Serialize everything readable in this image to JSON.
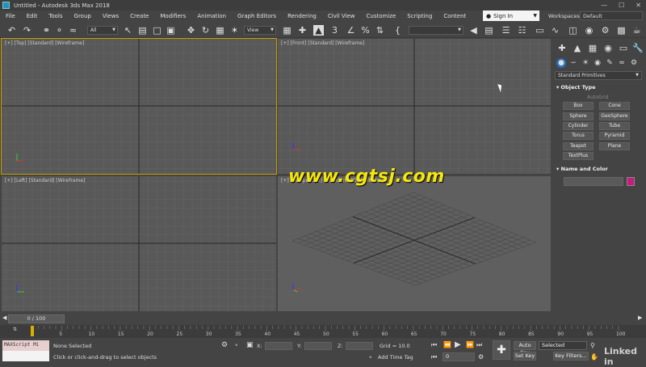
{
  "window": {
    "title": "Untitled - Autodesk 3ds Max 2018",
    "controls": [
      "—",
      "☐",
      "✕"
    ]
  },
  "menu": [
    "File",
    "Edit",
    "Tools",
    "Group",
    "Views",
    "Create",
    "Modifiers",
    "Animation",
    "Graph Editors",
    "Rendering",
    "Civil View",
    "Customize",
    "Scripting",
    "Content"
  ],
  "signin": {
    "label": "Sign In"
  },
  "workspaces": {
    "label": "Workspaces:",
    "value": "Default"
  },
  "toolbar": {
    "filter_value": "All",
    "refcoord_value": "View",
    "named_selection": ""
  },
  "viewports": [
    {
      "label": "[+] [Top] [Standard] [Wireframe]",
      "active": true
    },
    {
      "label": "[+] [Front] [Standard] [Wireframe]",
      "active": false
    },
    {
      "label": "[+] [Left] [Standard] [Wireframe]",
      "active": false
    },
    {
      "label": "[+] [Perspective] [Standard] [Default Shading]",
      "active": false
    }
  ],
  "command_panel": {
    "dropdown": "Standard Primitives",
    "object_type_title": "Object Type",
    "autogrid": "AutoGrid",
    "buttons": [
      "Box",
      "Cone",
      "Sphere",
      "GeoSphere",
      "Cylinder",
      "Tube",
      "Torus",
      "Pyramid",
      "Teapot",
      "Plane",
      "TextPlus"
    ],
    "name_color_title": "Name and Color",
    "swatch_color": "#c41d7c"
  },
  "time": {
    "slider_label": "0 / 100",
    "ticks": [
      "0",
      "5",
      "10",
      "15",
      "20",
      "25",
      "30",
      "35",
      "40",
      "45",
      "50",
      "55",
      "60",
      "65",
      "70",
      "75",
      "80",
      "85",
      "90",
      "95",
      "100"
    ]
  },
  "status": {
    "maxscript": "MAXScript Mi",
    "selection": "None Selected",
    "prompt": "Click or click-and-drag to select objects",
    "x_label": "X:",
    "y_label": "Y:",
    "z_label": "Z:",
    "grid": "Grid = 10.0",
    "add_time_tag": "Add Time Tag",
    "frame": "0",
    "auto_key": "Auto Key",
    "set_key": "Set Key",
    "selected": "Selected",
    "key_filters": "Key Filters..."
  },
  "watermark": "www.cgtsj.com",
  "brand": "Linked in"
}
